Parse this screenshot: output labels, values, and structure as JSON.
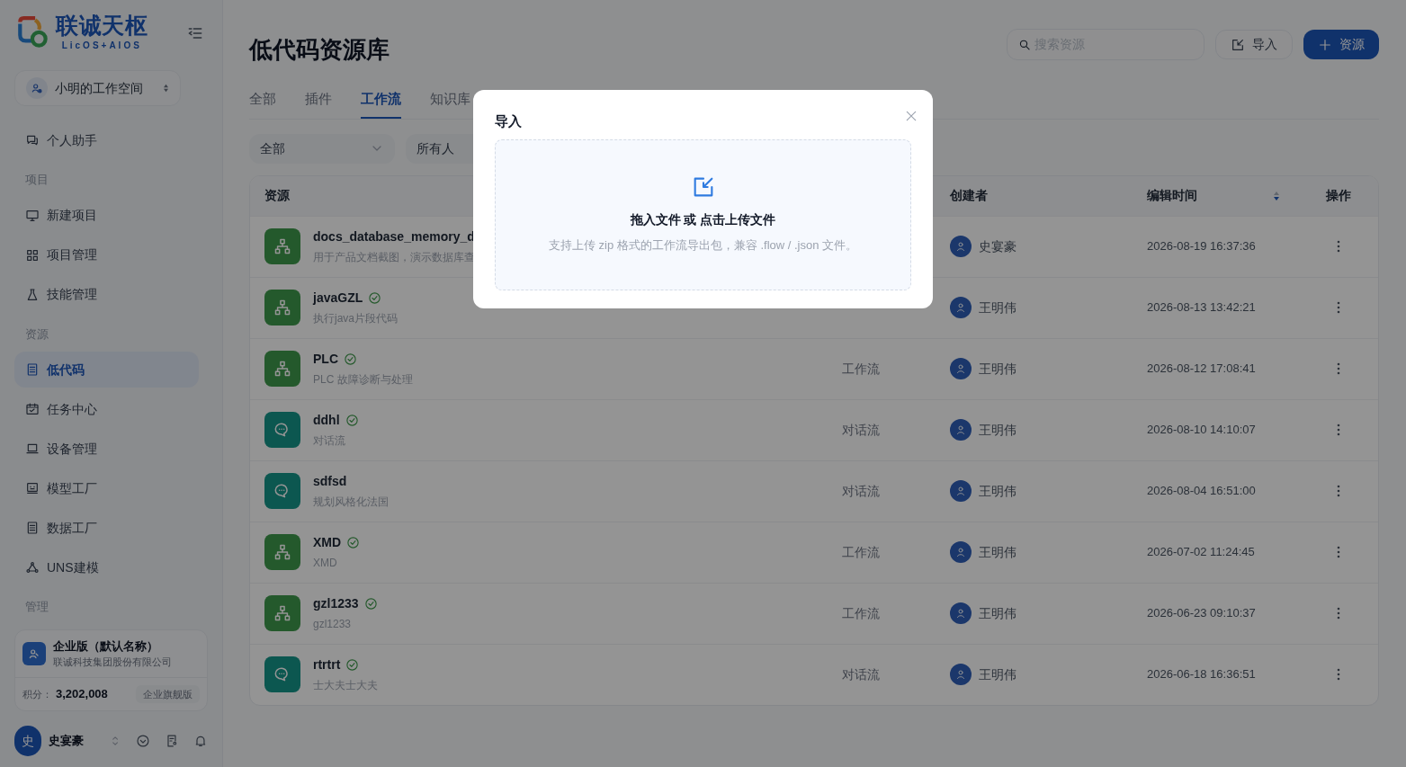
{
  "sidebar": {
    "logo": {
      "title": "联诚天枢",
      "subtitle": "LicOS+AIOS"
    },
    "workspace": "小明的工作空间",
    "items": [
      {
        "kind": "item",
        "label": "个人助手",
        "selected": false
      },
      {
        "kind": "section",
        "label": "项目"
      },
      {
        "kind": "item",
        "label": "新建项目",
        "selected": false
      },
      {
        "kind": "item",
        "label": "项目管理",
        "selected": false
      },
      {
        "kind": "item",
        "label": "技能管理",
        "selected": false
      },
      {
        "kind": "section",
        "label": "资源"
      },
      {
        "kind": "item",
        "label": "低代码",
        "selected": true
      },
      {
        "kind": "item",
        "label": "任务中心",
        "selected": false
      },
      {
        "kind": "item",
        "label": "设备管理",
        "selected": false
      },
      {
        "kind": "item",
        "label": "模型工厂",
        "selected": false
      },
      {
        "kind": "item",
        "label": "数据工厂",
        "selected": false
      },
      {
        "kind": "item",
        "label": "UNS建模",
        "selected": false
      },
      {
        "kind": "section",
        "label": "管理"
      }
    ],
    "org": {
      "name": "企业版（默认名称）",
      "company": "联诚科技集团股份有限公司",
      "points_label": "积分：",
      "points": "3,202,008",
      "plan": "企业旗舰版"
    },
    "user": {
      "avatar": "史",
      "name": "史宴豪"
    }
  },
  "header": {
    "title": "低代码资源库",
    "search": {
      "placeholder": "搜索资源"
    },
    "import_button": "导入",
    "add_button": "资源"
  },
  "tabs": [
    {
      "label": "全部",
      "selected": false
    },
    {
      "label": "插件",
      "selected": false
    },
    {
      "label": "工作流",
      "selected": true
    },
    {
      "label": "知识库",
      "selected": false
    }
  ],
  "filters": [
    "全部",
    "所有人"
  ],
  "table": {
    "columns": [
      "资源",
      "创建者",
      "编辑时间",
      "操作"
    ],
    "rows": [
      {
        "kind": "workflow",
        "name": "docs_database_memory_d",
        "verified": false,
        "description": "用于产品文档截图，演示数据库查",
        "creator": "史宴豪",
        "time": "2026-08-19 16:37:36"
      },
      {
        "kind": "workflow",
        "name": "javaGZL",
        "verified": true,
        "description": "执行java片段代码",
        "creator": "王明伟",
        "time": "2026-08-13 13:42:21"
      },
      {
        "kind": "workflow",
        "name": "PLC",
        "verified": true,
        "description": "PLC 故障诊断与处理",
        "type": "工作流",
        "creator": "王明伟",
        "time": "2026-08-12 17:08:41"
      },
      {
        "kind": "chat",
        "name": "ddhl",
        "verified": true,
        "description": "对话流",
        "type": "对话流",
        "creator": "王明伟",
        "time": "2026-08-10 14:10:07"
      },
      {
        "kind": "chat",
        "name": "sdfsd",
        "verified": false,
        "description": "规划风格化法国",
        "type": "对话流",
        "creator": "王明伟",
        "time": "2026-08-04 16:51:00"
      },
      {
        "kind": "workflow",
        "name": "XMD",
        "verified": true,
        "description": "XMD",
        "type": "工作流",
        "creator": "王明伟",
        "time": "2026-07-02 11:24:45"
      },
      {
        "kind": "workflow",
        "name": "gzl1233",
        "verified": true,
        "description": "gzl1233",
        "type": "工作流",
        "creator": "王明伟",
        "time": "2026-06-23 09:10:37"
      },
      {
        "kind": "chat",
        "name": "rtrtrt",
        "verified": true,
        "description": "士大夫士大夫",
        "type": "对话流",
        "creator": "王明伟",
        "time": "2026-06-18 16:36:51"
      }
    ]
  },
  "dialog": {
    "title": "导入",
    "drop_title": "拖入文件 或 点击上传文件",
    "drop_hint": "支持上传 zip 格式的工作流导出包，兼容 .flow / .json 文件。"
  }
}
